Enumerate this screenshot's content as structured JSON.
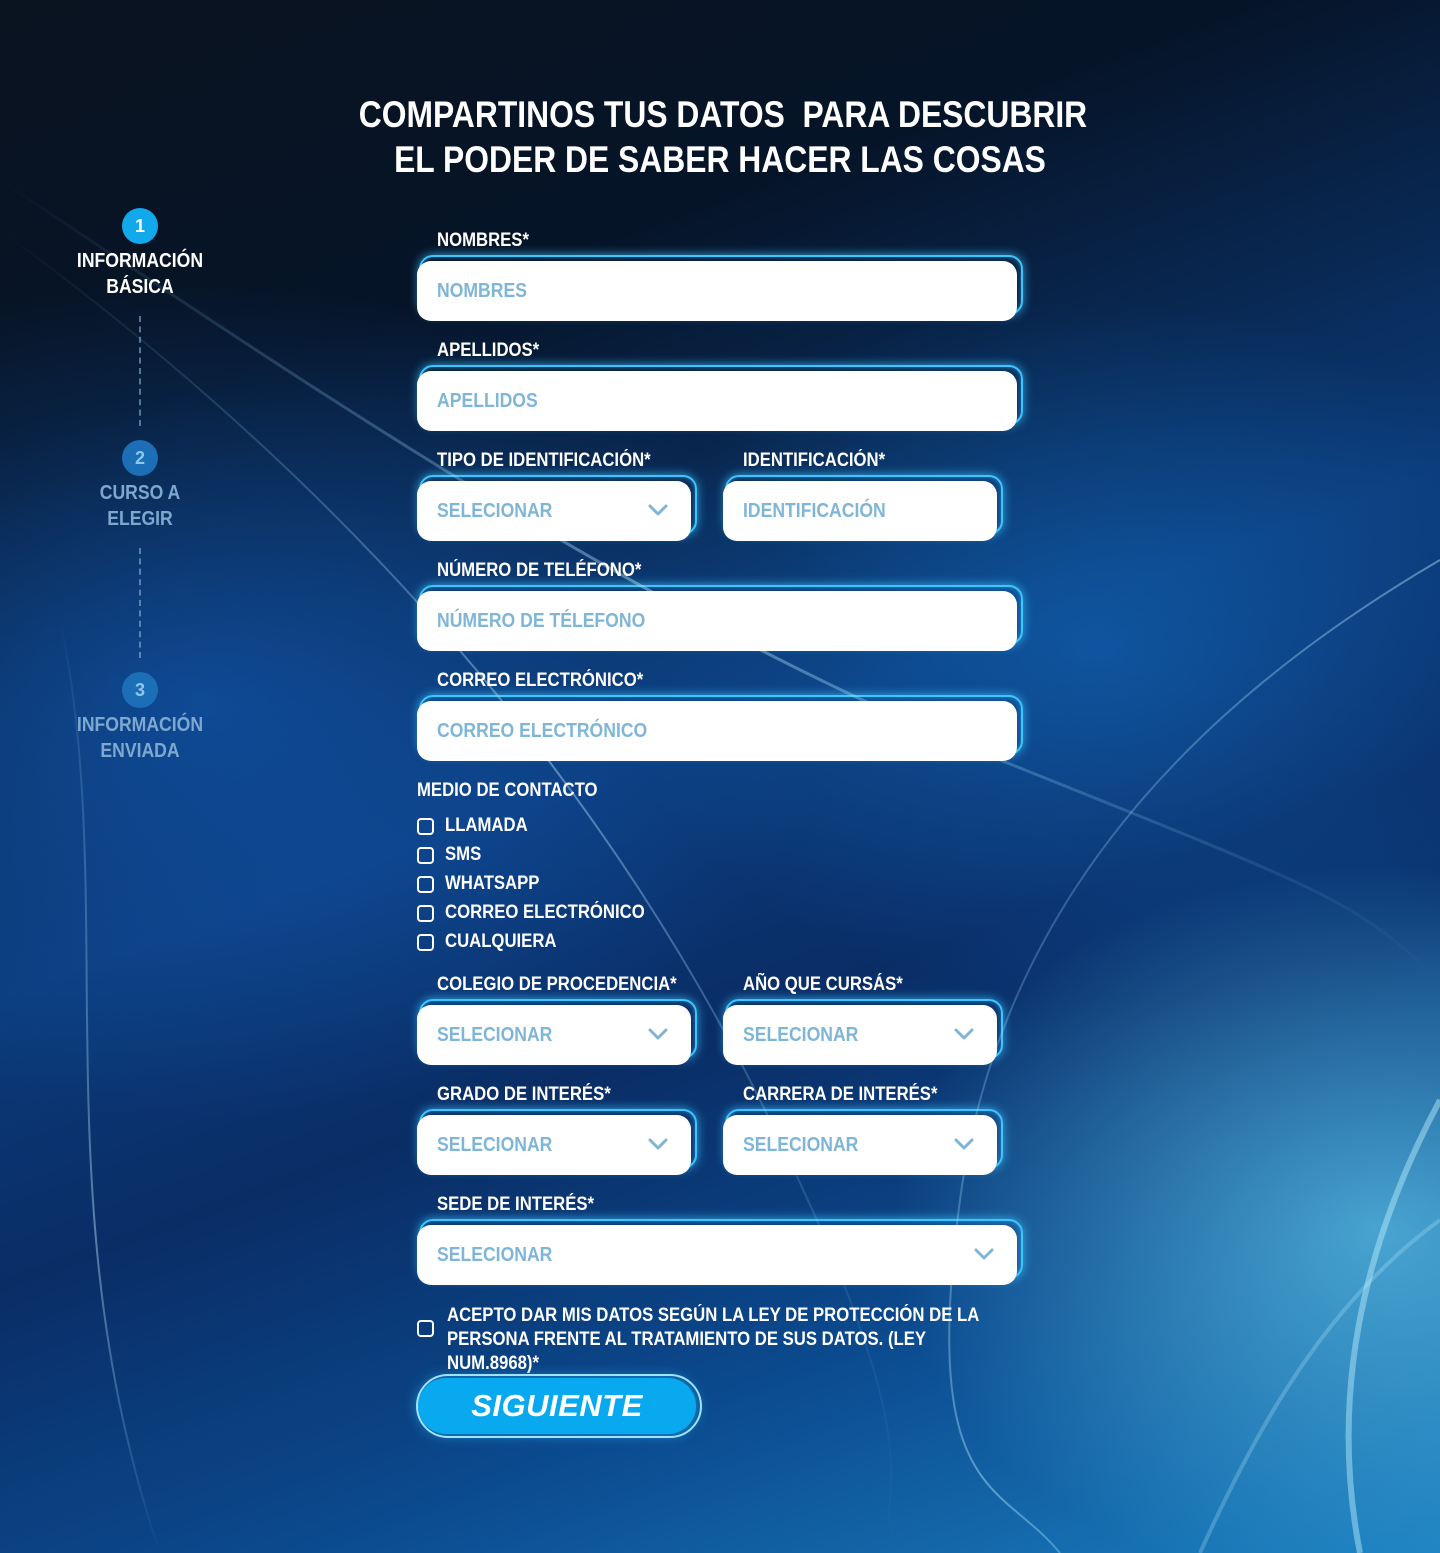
{
  "title": {
    "line1": "COMPARTINOS TUS DATOS  PARA DESCUBRIR",
    "line2": "EL PODER DE SABER HACER LAS COSAS"
  },
  "stepper": [
    {
      "number": "1",
      "line1": "INFORMACIÓN",
      "line2": "BÁSICA"
    },
    {
      "number": "2",
      "line1": "CURSO A",
      "line2": "ELEGIR"
    },
    {
      "number": "3",
      "line1": "INFORMACIÓN",
      "line2": "ENVIADA"
    }
  ],
  "form": {
    "nombres": {
      "label": "NOMBRES*",
      "placeholder": "NOMBRES"
    },
    "apellidos": {
      "label": "APELLIDOS*",
      "placeholder": "APELLIDOS"
    },
    "tipo_id": {
      "label": "TIPO DE IDENTIFICACIÓN*",
      "value": "SELECIONAR"
    },
    "identificacion": {
      "label": "IDENTIFICACIÓN*",
      "placeholder": "IDENTIFICACIÓN"
    },
    "telefono": {
      "label": "NÚMERO DE TELÉFONO*",
      "placeholder": "NÚMERO DE TÉLEFONO"
    },
    "correo": {
      "label": "CORREO ELECTRÓNICO*",
      "placeholder": "CORREO ELECTRÓNICO"
    },
    "medio": {
      "label": "MEDIO DE CONTACTO",
      "options": [
        "LLAMADA",
        "SMS",
        "WHATSAPP",
        "CORREO ELECTRÓNICO",
        "CUALQUIERA"
      ]
    },
    "colegio": {
      "label": "COLEGIO DE PROCEDENCIA*",
      "value": "SELECIONAR"
    },
    "anio": {
      "label": "AÑO QUE CURSÁS*",
      "value": "SELECIONAR"
    },
    "grado": {
      "label": "GRADO DE INTERÉS*",
      "value": "SELECIONAR"
    },
    "carrera": {
      "label": "CARRERA DE INTERÉS*",
      "value": "SELECIONAR"
    },
    "sede": {
      "label": "SEDE DE INTERÉS*",
      "value": "SELECIONAR"
    },
    "terms": {
      "line1": "ACEPTO DAR MIS DATOS SEGÚN LA LEY DE PROTECCIÓN DE LA",
      "line2": "PERSONA FRENTE AL TRATAMIENTO DE SUS DATOS. (LEY NUM.8968)*"
    },
    "submit_label": "SIGUIENTE"
  },
  "colors": {
    "accent": "#08a9ef",
    "placeholder": "#7fb6d8",
    "glow": "#3cc6ff"
  }
}
